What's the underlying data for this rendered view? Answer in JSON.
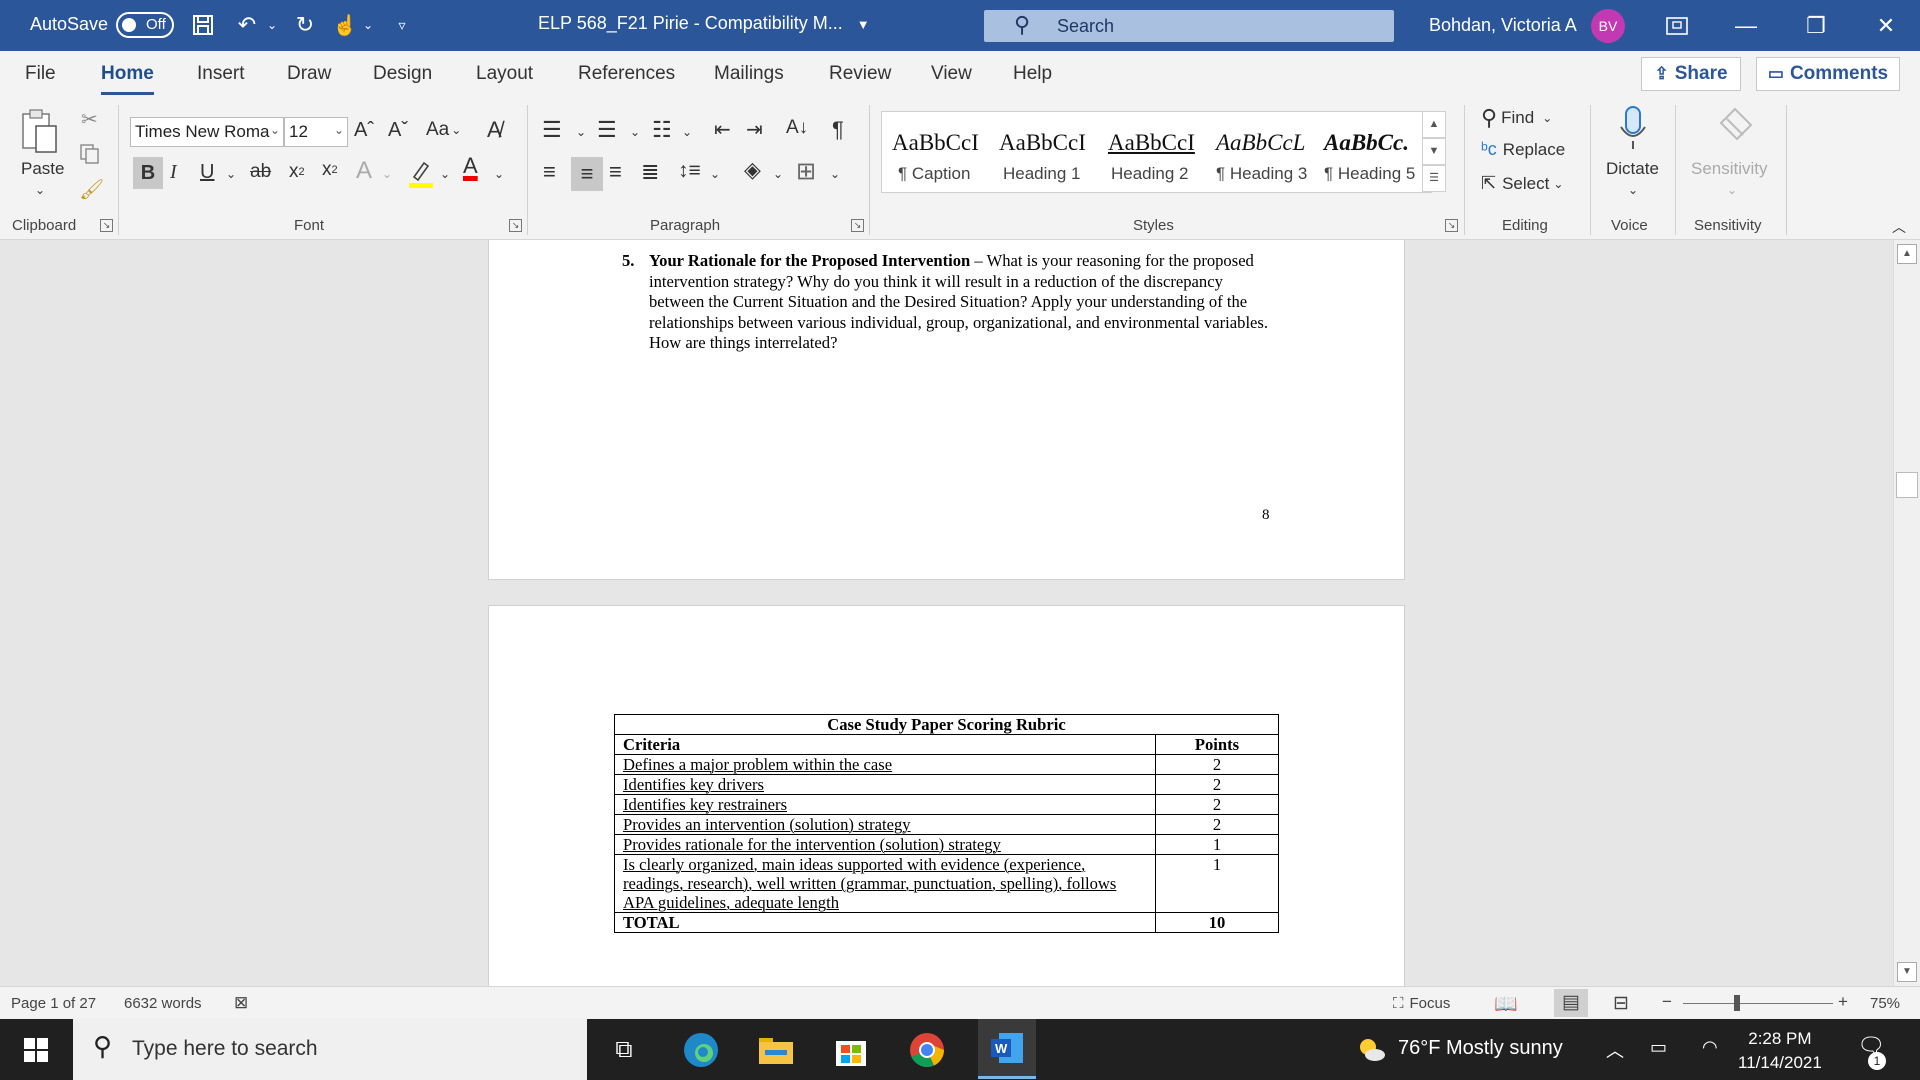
{
  "titlebar": {
    "autosave_label": "AutoSave",
    "autosave_state": "Off",
    "doc_title": "ELP 568_F21 Pirie  -  Compatibility M...",
    "search_placeholder": "Search",
    "user_name": "Bohdan, Victoria A",
    "user_initials": "BV",
    "accent": "#2b579a"
  },
  "tabs": [
    "File",
    "Home",
    "Insert",
    "Draw",
    "Design",
    "Layout",
    "References",
    "Mailings",
    "Review",
    "View",
    "Help"
  ],
  "active_tab": "Home",
  "share_label": "Share",
  "comments_label": "Comments",
  "ribbon": {
    "paste_label": "Paste",
    "font_name": "Times New Roma",
    "font_size": "12",
    "change_case": "Aa",
    "bold": "B",
    "italic": "I",
    "underline": "U",
    "strike": "ab",
    "groups": {
      "clipboard": "Clipboard",
      "font": "Font",
      "paragraph": "Paragraph",
      "styles": "Styles",
      "editing": "Editing",
      "voice": "Voice",
      "sensitivity": "Sensitivity"
    },
    "styles": [
      {
        "sample": "AaBbCcI",
        "name": "¶ Caption"
      },
      {
        "sample": "AaBbCcI",
        "name": "Heading 1"
      },
      {
        "sample": "AaBbCcI",
        "name": "Heading 2"
      },
      {
        "sample": "AaBbCcL",
        "name": "¶ Heading 3"
      },
      {
        "sample": "AaBbCc.",
        "name": "¶ Heading 5"
      }
    ],
    "find_label": "Find",
    "replace_label": "Replace",
    "select_label": "Select",
    "dictate_label": "Dictate",
    "sensitivity_label": "Sensitivity"
  },
  "document": {
    "q5_number": "5.",
    "q5_heading": "Your Rationale for the Proposed Intervention",
    "q5_body": " – What is your reasoning for the proposed intervention strategy?  Why do you think it will result in a reduction of the discrepancy between the Current Situation and the Desired Situation?  Apply your understanding of the relationships between various individual, group, organizational, and environmental variables.  How are things interrelated?",
    "page_number": "8",
    "rubric": {
      "caption": "Case Study Paper Scoring Rubric",
      "header_criteria": "Criteria",
      "header_points": "Points",
      "rows": [
        {
          "criteria": "Defines a major problem within the case",
          "points": "2"
        },
        {
          "criteria": "Identifies key drivers",
          "points": "2"
        },
        {
          "criteria": "Identifies key restrainers",
          "points": "2"
        },
        {
          "criteria": "Provides an intervention (solution) strategy",
          "points": "2"
        },
        {
          "criteria": "Provides rationale for the intervention (solution) strategy",
          "points": "1"
        },
        {
          "criteria": "Is clearly organized, main ideas supported with evidence (experience, readings, research), well written (grammar, punctuation, spelling), follows APA guidelines, adequate length",
          "points": "1"
        }
      ],
      "total_label": "TOTAL",
      "total_points": "10"
    }
  },
  "statusbar": {
    "page_info": "Page 1 of 27",
    "word_count": "6632 words",
    "focus_label": "Focus",
    "zoom_minus": "−",
    "zoom_plus": "+",
    "zoom_level": "75%"
  },
  "taskbar": {
    "search_placeholder": "Type here to search",
    "weather": "76°F  Mostly sunny",
    "time": "2:28 PM",
    "date": "11/14/2021",
    "notification_count": "1"
  }
}
